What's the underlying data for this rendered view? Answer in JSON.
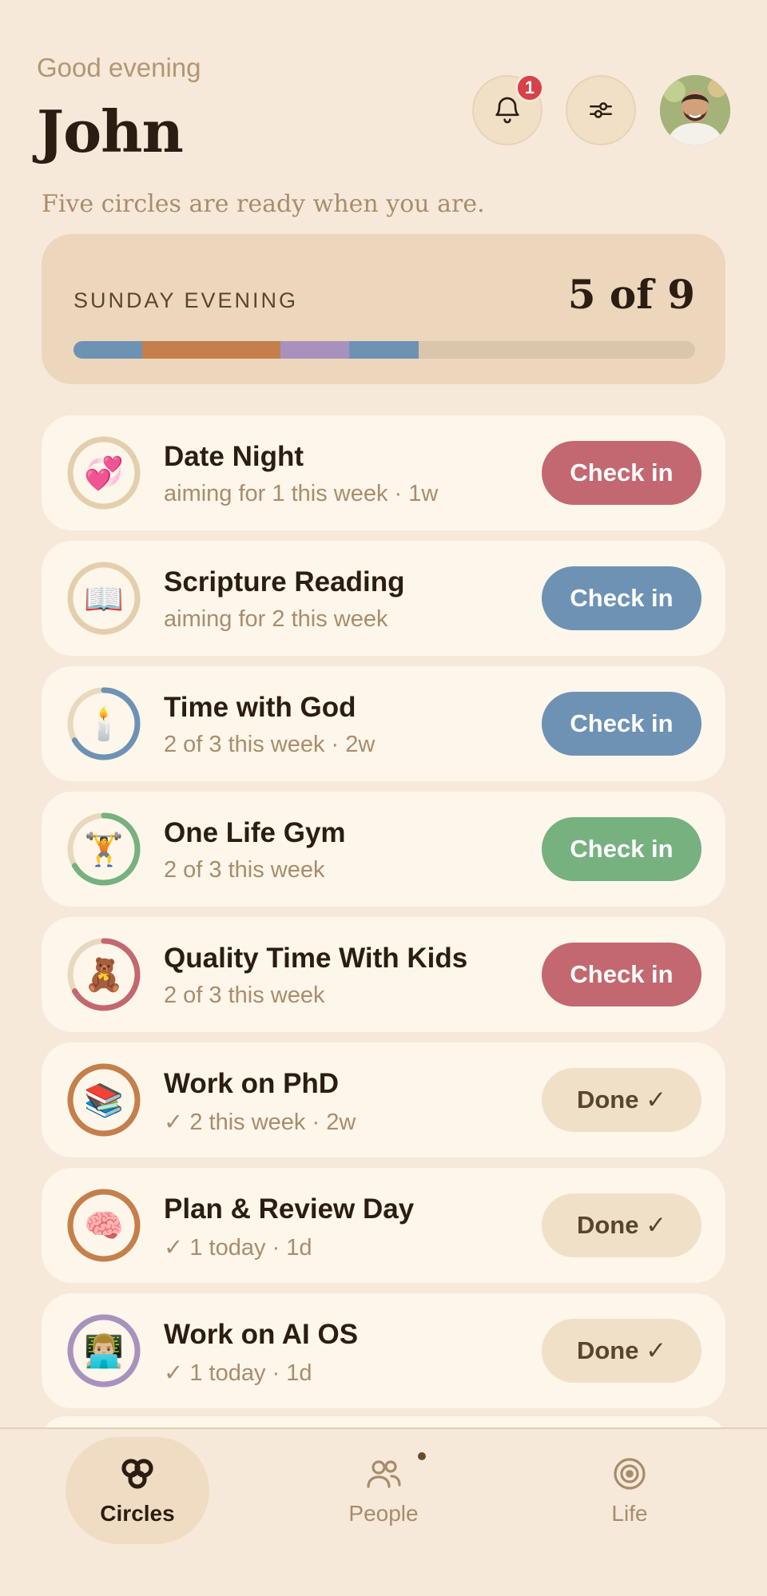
{
  "header": {
    "greeting": "Good evening",
    "name": "John",
    "subtitle": "Five circles are ready when you are.",
    "notifications_count": "1",
    "bell_icon": "bell-icon",
    "filter_icon": "sliders-icon"
  },
  "progress": {
    "period": "SUNDAY EVENING",
    "count": "5 of 9",
    "done": 5,
    "total": 9,
    "segments": [
      {
        "color": "#6e92b4",
        "fraction": 0.111
      },
      {
        "color": "#c47f4c",
        "fraction": 0.222
      },
      {
        "color": "#a892bd",
        "fraction": 0.111
      },
      {
        "color": "#6e92b4",
        "fraction": 0.111
      }
    ],
    "track_color": "#dac6ab"
  },
  "circles": [
    {
      "title": "Date Night",
      "subtitle": "aiming for 1 this week · 1w",
      "emoji": "💞",
      "action": "Check in",
      "state": "checkin",
      "color": "#c36870",
      "ring_color": "#e3cfad",
      "progress": 0
    },
    {
      "title": "Scripture Reading",
      "subtitle": "aiming for 2 this week",
      "emoji": "📖",
      "action": "Check in",
      "state": "checkin",
      "color": "#6e92b4",
      "ring_color": "#e3cfad",
      "progress": 0
    },
    {
      "title": "Time with God",
      "subtitle": "2 of 3 this week · 2w",
      "emoji": "🕯️",
      "action": "Check in",
      "state": "checkin",
      "color": "#6e92b4",
      "ring_color": "#6e92b4",
      "progress": 0.6667
    },
    {
      "title": "One Life Gym",
      "subtitle": "2 of 3 this week",
      "emoji": "🏋️",
      "action": "Check in",
      "state": "checkin",
      "color": "#76b17f",
      "ring_color": "#76b17f",
      "progress": 0.6667
    },
    {
      "title": "Quality Time With Kids",
      "subtitle": "2 of 3 this week",
      "emoji": "🧸",
      "action": "Check in",
      "state": "checkin",
      "color": "#c36870",
      "ring_color": "#c36870",
      "progress": 0.6667
    },
    {
      "title": "Work on PhD",
      "subtitle": "✓ 2 this week · 2w",
      "emoji": "📚",
      "action": "Done ✓",
      "state": "done",
      "color": "#f1e0c8",
      "ring_color": "#c47f4c",
      "progress": 1
    },
    {
      "title": "Plan & Review Day",
      "subtitle": "✓ 1 today · 1d",
      "emoji": "🧠",
      "action": "Done ✓",
      "state": "done",
      "color": "#f1e0c8",
      "ring_color": "#c47f4c",
      "progress": 1
    },
    {
      "title": "Work on AI OS",
      "subtitle": "✓ 1 today · 1d",
      "emoji": "👨🏼‍💻",
      "action": "Done ✓",
      "state": "done",
      "color": "#f1e0c8",
      "ring_color": "#a892bd",
      "progress": 1
    }
  ],
  "nav": {
    "items": [
      {
        "label": "Circles",
        "icon": "circles-icon",
        "active": true
      },
      {
        "label": "People",
        "icon": "people-icon",
        "active": false
      },
      {
        "label": "Life",
        "icon": "target-icon",
        "active": false
      }
    ]
  }
}
